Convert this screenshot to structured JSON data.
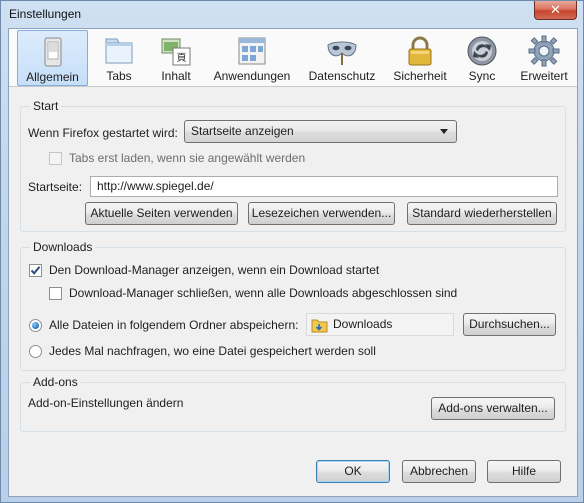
{
  "window": {
    "title": "Einstellungen",
    "close": "✕"
  },
  "toolbar": {
    "items": [
      {
        "label": "Allgemein",
        "icon": "switch-icon",
        "selected": true
      },
      {
        "label": "Tabs",
        "icon": "tabs-icon"
      },
      {
        "label": "Inhalt",
        "icon": "content-icon"
      },
      {
        "label": "Anwendungen",
        "icon": "applications-icon"
      },
      {
        "label": "Datenschutz",
        "icon": "privacy-mask-icon"
      },
      {
        "label": "Sicherheit",
        "icon": "padlock-icon"
      },
      {
        "label": "Sync",
        "icon": "sync-icon"
      },
      {
        "label": "Erweitert",
        "icon": "gear-icon"
      }
    ]
  },
  "start": {
    "legend": "Start",
    "when_label": "Wenn Firefox gestartet wird:",
    "when_value": "Startseite anzeigen",
    "tabs_lazy_label": "Tabs erst laden, wenn sie angewählt werden",
    "homepage_label": "Startseite:",
    "homepage_value": "http://www.spiegel.de/",
    "btn_current": "Aktuelle Seiten verwenden",
    "btn_bookmark": "Lesezeichen verwenden...",
    "btn_restore": "Standard wiederherstellen"
  },
  "downloads": {
    "legend": "Downloads",
    "show_manager_label": "Den Download-Manager anzeigen, wenn ein Download startet",
    "show_manager_checked": true,
    "close_manager_label": "Download-Manager schließen, wenn alle Downloads abgeschlossen sind",
    "close_manager_checked": false,
    "save_to_label": "Alle Dateien in folgendem Ordner abspeichern:",
    "folder": "Downloads",
    "browse": "Durchsuchen...",
    "ask_label": "Jedes Mal nachfragen, wo eine Datei gespeichert werden soll"
  },
  "addons": {
    "legend": "Add-ons",
    "text": "Add-on-Einstellungen ändern",
    "manage": "Add-ons verwalten..."
  },
  "footer": {
    "ok": "OK",
    "cancel": "Abbrechen",
    "help": "Hilfe"
  },
  "colors": {
    "accent": "#84acdd",
    "title_bar": "#c2d6ec"
  }
}
